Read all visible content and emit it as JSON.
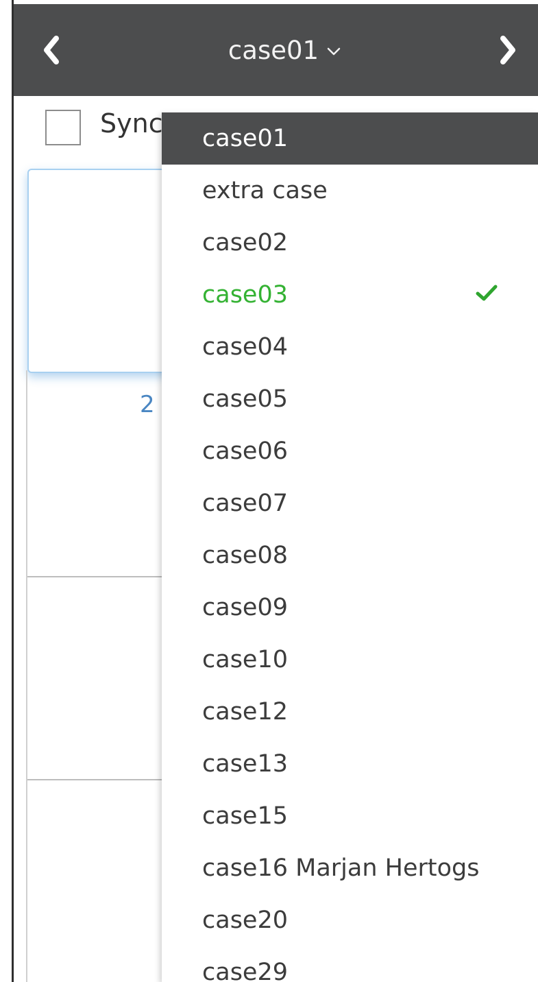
{
  "header": {
    "selected_case": "case01"
  },
  "sync": {
    "label": "Sync"
  },
  "page_number": "2",
  "dropdown": {
    "items": [
      {
        "label": "case01",
        "state": "active"
      },
      {
        "label": "extra case",
        "state": ""
      },
      {
        "label": "case02",
        "state": ""
      },
      {
        "label": "case03",
        "state": "checked"
      },
      {
        "label": "case04",
        "state": ""
      },
      {
        "label": "case05",
        "state": ""
      },
      {
        "label": "case06",
        "state": ""
      },
      {
        "label": "case07",
        "state": ""
      },
      {
        "label": "case08",
        "state": ""
      },
      {
        "label": "case09",
        "state": ""
      },
      {
        "label": "case10",
        "state": ""
      },
      {
        "label": "case12",
        "state": ""
      },
      {
        "label": "case13",
        "state": ""
      },
      {
        "label": "case15",
        "state": ""
      },
      {
        "label": "case16 Marjan Hertogs",
        "state": ""
      },
      {
        "label": "case20",
        "state": ""
      },
      {
        "label": "case29",
        "state": ""
      }
    ]
  },
  "icons": {
    "prev": "chevron-left-icon",
    "next": "chevron-right-icon",
    "dropdown_caret": "chevron-down-icon",
    "checkmark": "checkmark-icon"
  },
  "colors": {
    "header_bg": "#4c4d4e",
    "active_item_bg": "#4c4d4e",
    "checked_green": "#34b233",
    "page_number_blue": "#4a86c2"
  }
}
